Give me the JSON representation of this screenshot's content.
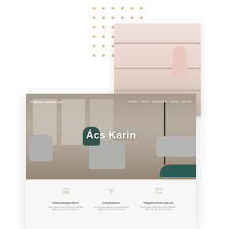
{
  "site": {
    "brand": "Fodrász szalon Acs",
    "nav": [
      "Kezdőlap",
      "Rólunk",
      "Szolgáltatások",
      "Galéria",
      "Kapcsolat"
    ],
    "hero_title": "Ács Karin"
  },
  "features": [
    {
      "icon": "image-icon",
      "title": "Hálószobagarnitúra",
      "desc": "Lorem ipsum dolor sit amet consectetur adipiscing elit sed do eiusmod"
    },
    {
      "icon": "diamond-icon",
      "title": "Konyhabútor",
      "desc": "Lorem ipsum dolor sit amet consectetur adipiscing elit sed do eiusmod"
    },
    {
      "icon": "image-icon",
      "title": "Nappaliszoba bútorok",
      "desc": "Lorem ipsum dolor sit amet consectetur adipiscing elit sed do eiusmod"
    }
  ],
  "colors": {
    "accent": "#f0a46a",
    "teal": "#2a5d54",
    "features_bg": "#f7f7f8"
  }
}
